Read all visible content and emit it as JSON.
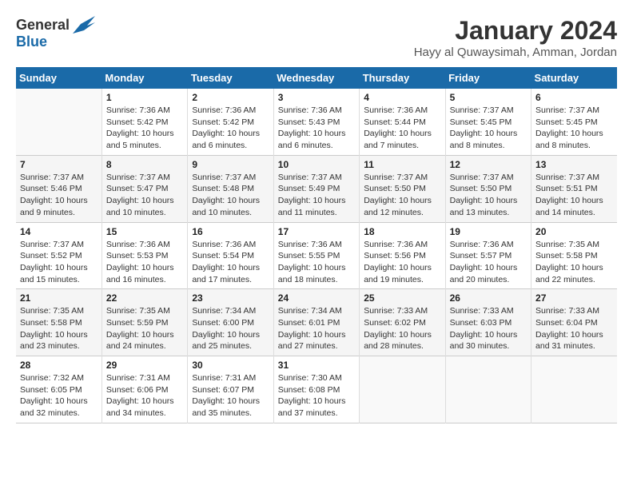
{
  "header": {
    "logo_general": "General",
    "logo_blue": "Blue",
    "title": "January 2024",
    "subtitle": "Hayy al Quwaysimah, Amman, Jordan"
  },
  "days_of_week": [
    "Sunday",
    "Monday",
    "Tuesday",
    "Wednesday",
    "Thursday",
    "Friday",
    "Saturday"
  ],
  "weeks": [
    [
      {
        "day": "",
        "info": ""
      },
      {
        "day": "1",
        "info": "Sunrise: 7:36 AM\nSunset: 5:42 PM\nDaylight: 10 hours\nand 5 minutes."
      },
      {
        "day": "2",
        "info": "Sunrise: 7:36 AM\nSunset: 5:42 PM\nDaylight: 10 hours\nand 6 minutes."
      },
      {
        "day": "3",
        "info": "Sunrise: 7:36 AM\nSunset: 5:43 PM\nDaylight: 10 hours\nand 6 minutes."
      },
      {
        "day": "4",
        "info": "Sunrise: 7:36 AM\nSunset: 5:44 PM\nDaylight: 10 hours\nand 7 minutes."
      },
      {
        "day": "5",
        "info": "Sunrise: 7:37 AM\nSunset: 5:45 PM\nDaylight: 10 hours\nand 8 minutes."
      },
      {
        "day": "6",
        "info": "Sunrise: 7:37 AM\nSunset: 5:45 PM\nDaylight: 10 hours\nand 8 minutes."
      }
    ],
    [
      {
        "day": "7",
        "info": "Sunrise: 7:37 AM\nSunset: 5:46 PM\nDaylight: 10 hours\nand 9 minutes."
      },
      {
        "day": "8",
        "info": "Sunrise: 7:37 AM\nSunset: 5:47 PM\nDaylight: 10 hours\nand 10 minutes."
      },
      {
        "day": "9",
        "info": "Sunrise: 7:37 AM\nSunset: 5:48 PM\nDaylight: 10 hours\nand 10 minutes."
      },
      {
        "day": "10",
        "info": "Sunrise: 7:37 AM\nSunset: 5:49 PM\nDaylight: 10 hours\nand 11 minutes."
      },
      {
        "day": "11",
        "info": "Sunrise: 7:37 AM\nSunset: 5:50 PM\nDaylight: 10 hours\nand 12 minutes."
      },
      {
        "day": "12",
        "info": "Sunrise: 7:37 AM\nSunset: 5:50 PM\nDaylight: 10 hours\nand 13 minutes."
      },
      {
        "day": "13",
        "info": "Sunrise: 7:37 AM\nSunset: 5:51 PM\nDaylight: 10 hours\nand 14 minutes."
      }
    ],
    [
      {
        "day": "14",
        "info": "Sunrise: 7:37 AM\nSunset: 5:52 PM\nDaylight: 10 hours\nand 15 minutes."
      },
      {
        "day": "15",
        "info": "Sunrise: 7:36 AM\nSunset: 5:53 PM\nDaylight: 10 hours\nand 16 minutes."
      },
      {
        "day": "16",
        "info": "Sunrise: 7:36 AM\nSunset: 5:54 PM\nDaylight: 10 hours\nand 17 minutes."
      },
      {
        "day": "17",
        "info": "Sunrise: 7:36 AM\nSunset: 5:55 PM\nDaylight: 10 hours\nand 18 minutes."
      },
      {
        "day": "18",
        "info": "Sunrise: 7:36 AM\nSunset: 5:56 PM\nDaylight: 10 hours\nand 19 minutes."
      },
      {
        "day": "19",
        "info": "Sunrise: 7:36 AM\nSunset: 5:57 PM\nDaylight: 10 hours\nand 20 minutes."
      },
      {
        "day": "20",
        "info": "Sunrise: 7:35 AM\nSunset: 5:58 PM\nDaylight: 10 hours\nand 22 minutes."
      }
    ],
    [
      {
        "day": "21",
        "info": "Sunrise: 7:35 AM\nSunset: 5:58 PM\nDaylight: 10 hours\nand 23 minutes."
      },
      {
        "day": "22",
        "info": "Sunrise: 7:35 AM\nSunset: 5:59 PM\nDaylight: 10 hours\nand 24 minutes."
      },
      {
        "day": "23",
        "info": "Sunrise: 7:34 AM\nSunset: 6:00 PM\nDaylight: 10 hours\nand 25 minutes."
      },
      {
        "day": "24",
        "info": "Sunrise: 7:34 AM\nSunset: 6:01 PM\nDaylight: 10 hours\nand 27 minutes."
      },
      {
        "day": "25",
        "info": "Sunrise: 7:33 AM\nSunset: 6:02 PM\nDaylight: 10 hours\nand 28 minutes."
      },
      {
        "day": "26",
        "info": "Sunrise: 7:33 AM\nSunset: 6:03 PM\nDaylight: 10 hours\nand 30 minutes."
      },
      {
        "day": "27",
        "info": "Sunrise: 7:33 AM\nSunset: 6:04 PM\nDaylight: 10 hours\nand 31 minutes."
      }
    ],
    [
      {
        "day": "28",
        "info": "Sunrise: 7:32 AM\nSunset: 6:05 PM\nDaylight: 10 hours\nand 32 minutes."
      },
      {
        "day": "29",
        "info": "Sunrise: 7:31 AM\nSunset: 6:06 PM\nDaylight: 10 hours\nand 34 minutes."
      },
      {
        "day": "30",
        "info": "Sunrise: 7:31 AM\nSunset: 6:07 PM\nDaylight: 10 hours\nand 35 minutes."
      },
      {
        "day": "31",
        "info": "Sunrise: 7:30 AM\nSunset: 6:08 PM\nDaylight: 10 hours\nand 37 minutes."
      },
      {
        "day": "",
        "info": ""
      },
      {
        "day": "",
        "info": ""
      },
      {
        "day": "",
        "info": ""
      }
    ]
  ]
}
